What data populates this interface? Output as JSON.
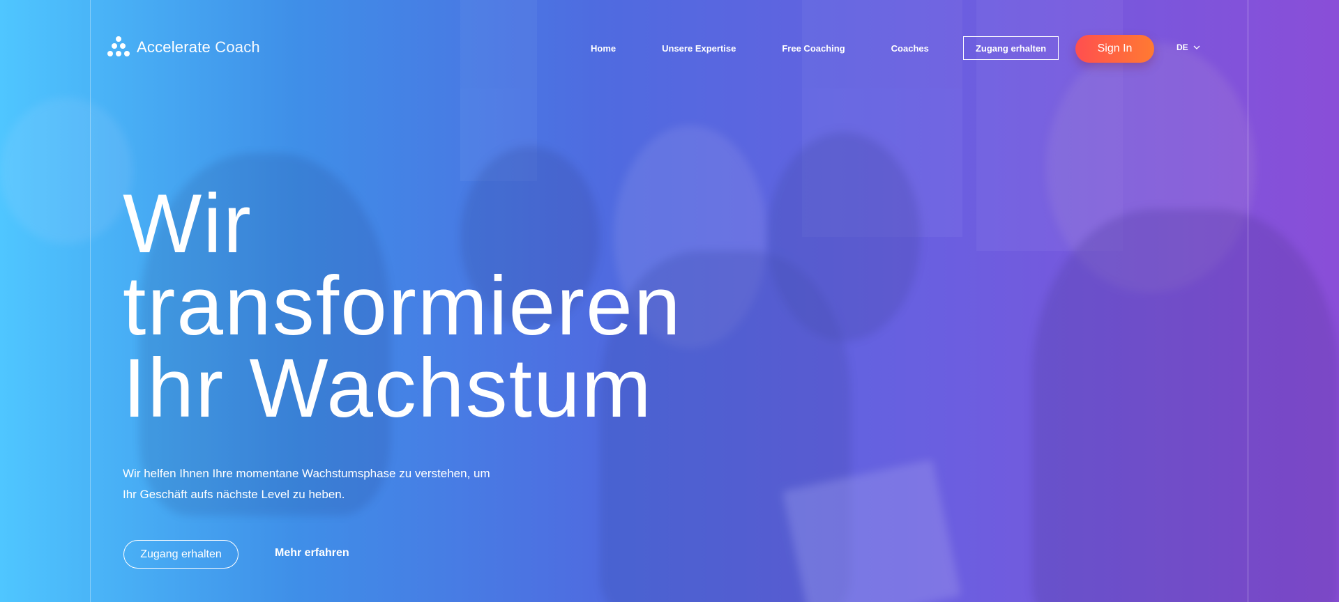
{
  "header": {
    "logo": {
      "brand_bold": "Accelerate",
      "brand_light": "Coach"
    },
    "nav": [
      {
        "label": "Home"
      },
      {
        "label": "Unsere Expertise"
      },
      {
        "label": "Free Coaching"
      },
      {
        "label": "Coaches"
      }
    ],
    "access_button": "Zugang erhalten",
    "signin_button": "Sign In",
    "language": "DE"
  },
  "hero": {
    "headline_lines": [
      "Wir",
      "transformieren",
      "Ihr Wachstum"
    ],
    "subtext_lines": [
      "Wir helfen Ihnen Ihre momentane Wachstumsphase zu verstehen, um",
      "Ihr Geschäft aufs nächste Level zu heben."
    ],
    "cta_primary": "Zugang erhalten",
    "cta_secondary": "Mehr erfahren"
  },
  "colors": {
    "gradient_start": "#4fc6ff",
    "gradient_end": "#8a4ed8",
    "signin_start": "#ff4f4f",
    "signin_end": "#ff7a32",
    "text": "#ffffff"
  },
  "icons": {
    "logo": "dots-triangle-logo-icon",
    "language_chevron": "chevron-down-icon"
  }
}
